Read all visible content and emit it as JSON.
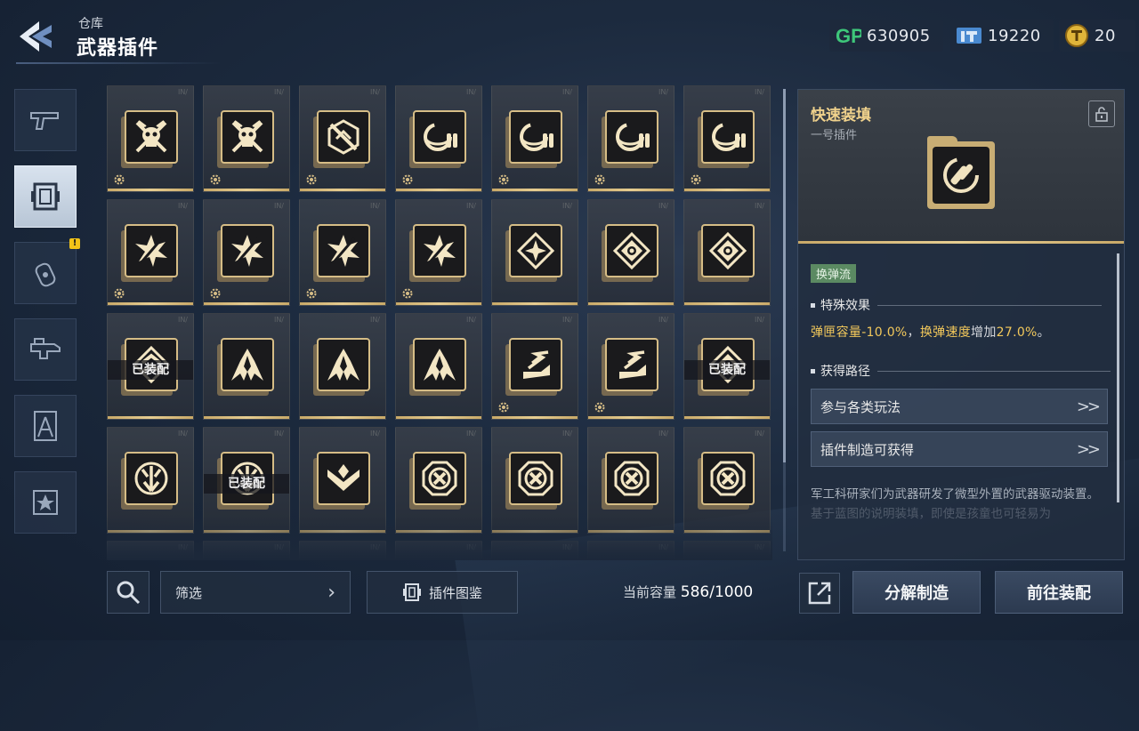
{
  "header": {
    "breadcrumb": "仓库",
    "title": "武器插件",
    "currencies": [
      {
        "icon": "gp-icon",
        "value": "630905"
      },
      {
        "icon": "ticket-icon",
        "value": "19220"
      },
      {
        "icon": "gold-coin-icon",
        "value": "20"
      }
    ]
  },
  "sidebar": {
    "tabs": [
      {
        "icon": "pistol-icon",
        "active": false
      },
      {
        "icon": "plugin-chip-icon",
        "active": true
      },
      {
        "icon": "grenade-icon",
        "active": false,
        "alert": "!"
      },
      {
        "icon": "gun-mod-icon",
        "active": false
      },
      {
        "icon": "compass-tool-icon",
        "active": false
      },
      {
        "icon": "star-badge-icon",
        "active": false
      }
    ]
  },
  "grid": {
    "equipped_label": "已装配",
    "cells": [
      {
        "icon": "skull-crossed-swords",
        "gear": true,
        "equipped": false
      },
      {
        "icon": "skull-crossed-swords",
        "gear": true,
        "equipped": false
      },
      {
        "icon": "hex-slash",
        "gear": true,
        "equipped": false
      },
      {
        "icon": "reload-bullets",
        "gear": true,
        "equipped": false
      },
      {
        "icon": "reload-bullets",
        "gear": true,
        "equipped": false
      },
      {
        "icon": "reload-bullets",
        "gear": true,
        "equipped": false
      },
      {
        "icon": "reload-bullets",
        "gear": true,
        "equipped": false
      },
      {
        "icon": "shatter-star",
        "gear": true,
        "equipped": false
      },
      {
        "icon": "shatter-star",
        "gear": true,
        "equipped": false
      },
      {
        "icon": "shatter-star",
        "gear": true,
        "equipped": false
      },
      {
        "icon": "shatter-star",
        "gear": true,
        "equipped": false
      },
      {
        "icon": "diamond-star",
        "gear": false,
        "equipped": false
      },
      {
        "icon": "diamond-eye",
        "gear": false,
        "equipped": false
      },
      {
        "icon": "diamond-eye",
        "gear": false,
        "equipped": false
      },
      {
        "icon": "diamond-chevron",
        "gear": false,
        "equipped": true
      },
      {
        "icon": "flame-claw",
        "gear": false,
        "equipped": false
      },
      {
        "icon": "flame-claw",
        "gear": false,
        "equipped": false
      },
      {
        "icon": "flame-claw",
        "gear": false,
        "equipped": false
      },
      {
        "icon": "dash-boot",
        "gear": true,
        "equipped": false
      },
      {
        "icon": "dash-boot",
        "gear": true,
        "equipped": false
      },
      {
        "icon": "diamond-eye",
        "gear": false,
        "equipped": true
      },
      {
        "icon": "burst-arrow",
        "gear": false,
        "equipped": false
      },
      {
        "icon": "burst-arrow",
        "gear": false,
        "equipped": true
      },
      {
        "icon": "wing-chevron",
        "gear": false,
        "equipped": false
      },
      {
        "icon": "octagon-x",
        "gear": false,
        "equipped": false
      },
      {
        "icon": "octagon-x",
        "gear": false,
        "equipped": false
      },
      {
        "icon": "octagon-x",
        "gear": false,
        "equipped": false
      },
      {
        "icon": "octagon-x",
        "gear": false,
        "equipped": false
      },
      {
        "icon": "partial",
        "gear": false,
        "equipped": false
      },
      {
        "icon": "partial",
        "gear": false,
        "equipped": false
      },
      {
        "icon": "partial",
        "gear": false,
        "equipped": false
      },
      {
        "icon": "partial",
        "gear": false,
        "equipped": false
      },
      {
        "icon": "partial",
        "gear": false,
        "equipped": false
      },
      {
        "icon": "partial",
        "gear": false,
        "equipped": false
      },
      {
        "icon": "partial",
        "gear": false,
        "equipped": false
      }
    ]
  },
  "detail": {
    "name": "快速装填",
    "sub": "一号插件",
    "tag": "换弹流",
    "effect_title": "特殊效果",
    "effect": {
      "p1": "弹匣容量",
      "v1": "-10.0%",
      "p2": "，",
      "p3": "换弹速度",
      "p4": "增加",
      "v2": "27.0%",
      "p5": "。"
    },
    "route_title": "获得路径",
    "routes": [
      "参与各类玩法",
      "插件制造可获得"
    ],
    "desc": "军工科研家们为武器研发了微型外置的武器驱动装置。",
    "desc_faded": "基于蓝图的说明装填，即使是孩童也可轻易为"
  },
  "bottom": {
    "filter_label": "筛选",
    "atlas_label": "插件图鉴",
    "capacity_label": "当前容量",
    "capacity_current": "586",
    "capacity_max": "/1000",
    "decompose_label": "分解制造",
    "goto_label": "前往装配"
  },
  "colors": {
    "gold": "#d6bd86",
    "highlight": "#f2c85b",
    "tag_green": "#5b8a62"
  }
}
